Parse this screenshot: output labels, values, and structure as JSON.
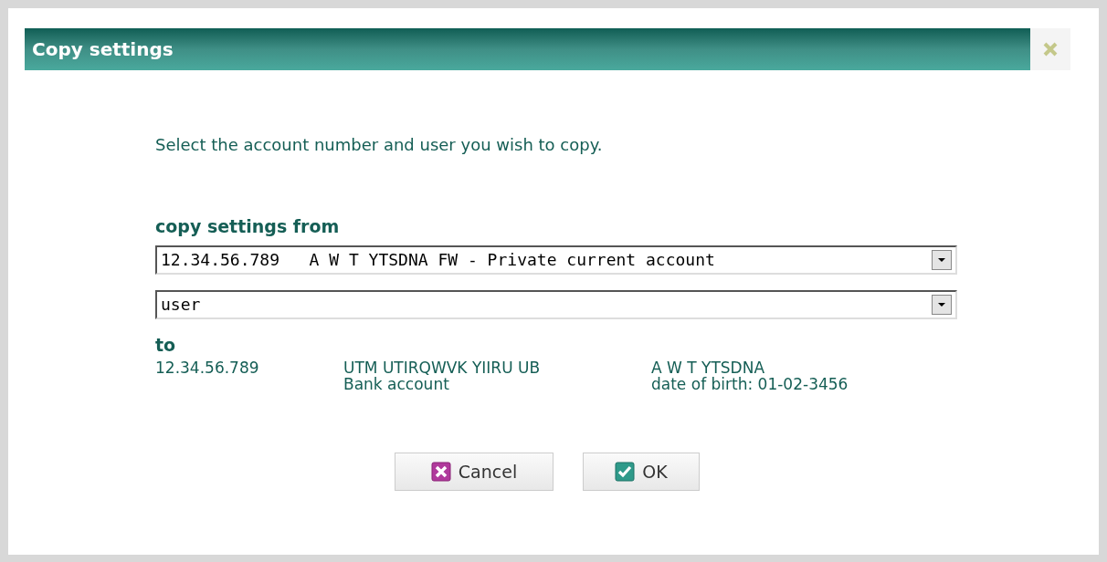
{
  "dialog": {
    "title": "Copy settings"
  },
  "instruction": "Select the account number and user you wish to copy.",
  "from": {
    "heading": "copy settings from",
    "account_select": "12.34.56.789   A W T YTSDNA FW - Private current account",
    "user_select": "user"
  },
  "to": {
    "heading": "to",
    "account_number": "12.34.56.789",
    "bank_name": "UTM UTIRQWVK YIIRU UB",
    "account_type": "Bank account",
    "holder_name": "A W T YTSDNA",
    "birth_date": "date of birth: 01-02-3456"
  },
  "buttons": [
    {
      "label": "Cancel",
      "kind": "cancel"
    },
    {
      "label": "OK",
      "kind": "ok"
    }
  ]
}
